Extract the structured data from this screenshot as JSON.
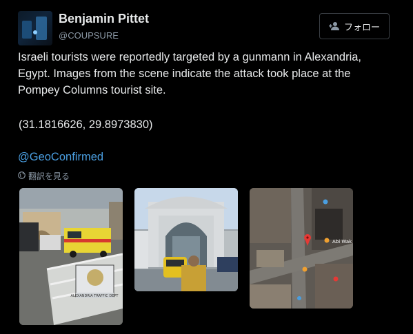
{
  "author": {
    "name": "Benjamin Pittet",
    "handle": "@COUPSURE"
  },
  "follow_button": {
    "label": "フォロー",
    "icon": "add-user-icon"
  },
  "tweet": {
    "text": "Israeli tourists were reportedly targeted by a gunmann in Alexandria, Egypt. Images from the scene indicate the attack took place at the Pompey Columns tourist site.",
    "coordinates": "(31.1816626, 29.8973830)",
    "mention": "@GeoConfirmed",
    "translate_label": "翻訳を見る"
  },
  "images": {
    "barrier_sign_text": "ALEXANDRIA TRAFFIC DEPT",
    "map_labels": [
      "Abi Wak"
    ]
  },
  "colors": {
    "background": "#000000",
    "text": "#e7e9ea",
    "muted": "#8b98a5",
    "link": "#4a9ee0"
  }
}
